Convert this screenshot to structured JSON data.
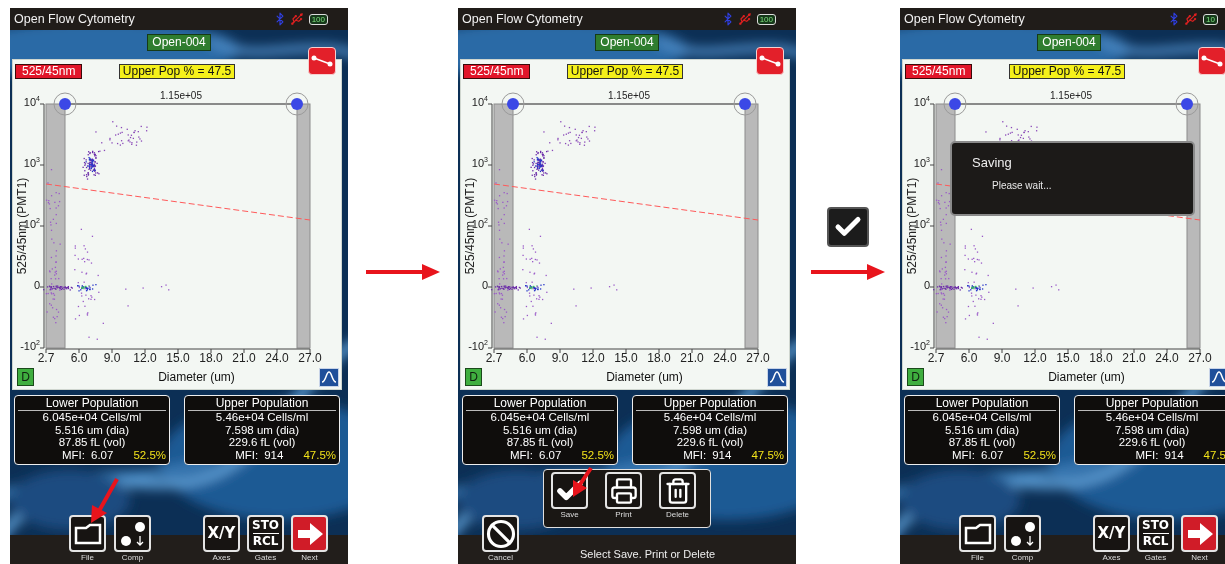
{
  "screens": [
    {
      "kind": "plot",
      "title": "Open Flow Cytometry",
      "battery": "100",
      "sample": "Open-004",
      "channel": "525/45nm",
      "gate_readout": "Upper Pop % = 47.5",
      "display_button": "D",
      "plot": {
        "y_title": "525/45nm (PMT1)",
        "x_title": "Diameter (um)",
        "gate_count": "1.15e+05",
        "x_ticks": [
          "2.7",
          "6.0",
          "9.0",
          "12.0",
          "15.0",
          "18.0",
          "21.0",
          "24.0",
          "27.0"
        ],
        "y_ticks": [
          "10$^{4}$",
          "10$^{3}$",
          "10$^{2}$",
          "0",
          "-10$^{2}$"
        ]
      },
      "populations": [
        {
          "title": "Lower Population",
          "lines": [
            "6.045e+04 Cells/ml",
            "5.516 um (dia)",
            "87.85 fL (vol)"
          ],
          "mfi_label": "MFI:",
          "mfi": "6.07",
          "percent": "52.5%"
        },
        {
          "title": "Upper Population",
          "lines": [
            "5.46e+04 Cells/ml",
            "7.598 um (dia)",
            "229.6 fL (vol)"
          ],
          "mfi_label": "MFI:",
          "mfi": "914",
          "percent": "47.5%"
        }
      ],
      "toolbar": [
        {
          "kind": "file",
          "caption": "File",
          "pointed": true
        },
        {
          "kind": "comp",
          "caption": "Comp",
          "pointed": false
        },
        {
          "kind": "axes",
          "label": "X/Y",
          "caption": "Axes",
          "pointed": false
        },
        {
          "kind": "gates",
          "label": "STO",
          "label_2": "RCL",
          "caption": "Gates",
          "pointed": false
        },
        {
          "kind": "next",
          "caption": "Next",
          "pointed": false
        }
      ]
    },
    {
      "kind": "plot",
      "title": "Open Flow Cytometry",
      "battery": "100",
      "sample": "Open-004",
      "channel": "525/45nm",
      "gate_readout": "Upper Pop % = 47.5",
      "display_button": "D",
      "plot": {
        "y_title": "525/45nm (PMT1)",
        "x_title": "Diameter (um)",
        "gate_count": "1.15e+05",
        "x_ticks": [
          "2.7",
          "6.0",
          "9.0",
          "12.0",
          "15.0",
          "18.0",
          "21.0",
          "24.0",
          "27.0"
        ],
        "y_ticks": [
          "10$^{4}$",
          "10$^{3}$",
          "10$^{2}$",
          "0",
          "-10$^{2}$"
        ]
      },
      "populations": [
        {
          "title": "Lower Population",
          "lines": [
            "6.045e+04 Cells/ml",
            "5.516 um (dia)",
            "87.85 fL (vol)"
          ],
          "mfi_label": "MFI:",
          "mfi": "6.07",
          "percent": "52.5%"
        },
        {
          "title": "Upper Population",
          "lines": [
            "5.46e+04 Cells/ml",
            "7.598 um (dia)",
            "229.6 fL (vol)"
          ],
          "mfi_label": "MFI:",
          "mfi": "914",
          "percent": "47.5%"
        }
      ],
      "menu": [
        {
          "kind": "save",
          "caption": "Save",
          "pointed": true
        },
        {
          "kind": "print",
          "caption": "Print",
          "pointed": false
        },
        {
          "kind": "delete",
          "caption": "Delete",
          "pointed": false
        }
      ],
      "toolbar": [
        {
          "kind": "cancel",
          "caption": "Cancel",
          "pointed": false
        }
      ],
      "status": "Select Save. Print or Delete"
    },
    {
      "kind": "plot",
      "title": "Open Flow Cytometry",
      "battery": "10",
      "sample": "Open-004",
      "channel": "525/45nm",
      "gate_readout": "Upper Pop % = 47.5",
      "display_button": "D",
      "plot": {
        "y_title": "525/45nm (PMT1)",
        "x_title": "Diameter (um)",
        "gate_count": "1.15e+05",
        "x_ticks": [
          "2.7",
          "6.0",
          "9.0",
          "12.0",
          "15.0",
          "18.0",
          "21.0",
          "24.0",
          "27.0"
        ],
        "y_ticks": [
          "10$^{4}$",
          "10$^{3}$",
          "10$^{2}$",
          "0",
          "-10$^{2}$"
        ]
      },
      "dialog": {
        "title": "Saving",
        "message": "Please wait..."
      },
      "populations": [
        {
          "title": "Lower Population",
          "lines": [
            "6.045e+04 Cells/ml",
            "5.516 um (dia)",
            "87.85 fL (vol)"
          ],
          "mfi_label": "MFI:",
          "mfi": "6.07",
          "percent": "52.5%"
        },
        {
          "title": "Upper Population",
          "lines": [
            "5.46e+04 Cells/ml",
            "7.598 um (dia)",
            "229.6 fL (vol)"
          ],
          "mfi_label": "MFI:",
          "mfi": "914",
          "percent": "47.5"
        }
      ],
      "toolbar": [
        {
          "kind": "file",
          "caption": "File",
          "pointed": false
        },
        {
          "kind": "comp",
          "caption": "Comp",
          "pointed": false
        },
        {
          "kind": "axes",
          "label": "X/Y",
          "caption": "Axes",
          "pointed": false
        },
        {
          "kind": "gates",
          "label": "STO",
          "label_2": "RCL",
          "caption": "Gates",
          "pointed": false
        },
        {
          "kind": "next",
          "caption": "Next",
          "pointed": false
        }
      ]
    }
  ],
  "transitions": [
    {
      "kind": "arrow",
      "checkmark": false
    },
    {
      "kind": "arrow",
      "checkmark": true
    }
  ]
}
